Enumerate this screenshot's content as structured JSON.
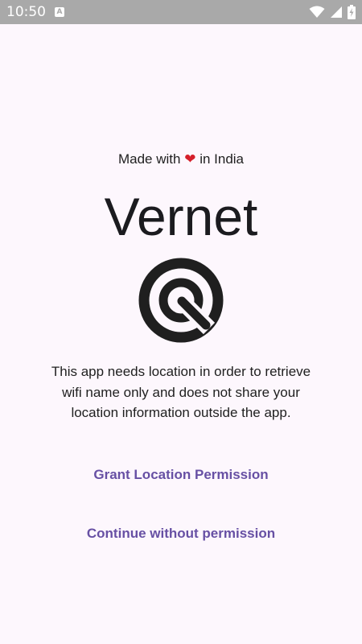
{
  "status_bar": {
    "time": "10:50",
    "notification_glyph": "A",
    "icons": [
      "wifi-icon",
      "signal-icon",
      "battery-charging-icon"
    ]
  },
  "made_with": {
    "prefix": "Made with",
    "heart": "❤",
    "suffix": "in India"
  },
  "app_title": "Vernet",
  "logo_icon": "target-radar-icon",
  "description": "This app needs location in order to retrieve wifi name only and does not share your location information outside the app.",
  "buttons": {
    "grant": "Grant Location Permission",
    "continue": "Continue without permission"
  },
  "colors": {
    "background": "#fdf7fd",
    "status_bar": "#a9a9a9",
    "accent": "#6750a4",
    "heart": "#d51f2a",
    "text": "#1f1f1f"
  }
}
